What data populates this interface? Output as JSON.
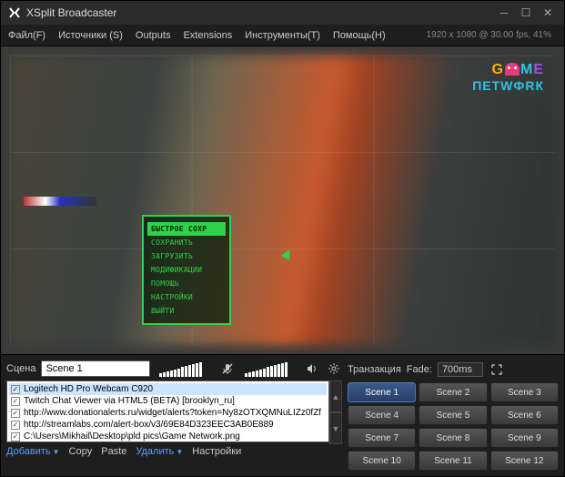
{
  "titlebar": {
    "title": "XSplit Broadcaster"
  },
  "menu": {
    "file": "Файл(F)",
    "sources": "Источники (S)",
    "outputs": "Outputs",
    "extensions": "Extensions",
    "tools": "Инструменты(T)",
    "help": "Помощь(H)",
    "status": "1920 x 1080 @ 30.00 fps, 41%"
  },
  "in_game_menu": {
    "items": [
      "БЫСТРОЕ СОХР",
      "СОХРАНИТЬ",
      "ЗАГРУЗИТЬ",
      "МОДИФИКАЦИИ",
      "ПОМОЩЬ",
      "НАСТРОЙКИ",
      "ВЫЙТИ"
    ],
    "selected_index": 0
  },
  "scene_panel": {
    "label": "Сцена",
    "current_scene": "Scene 1"
  },
  "sources_list": [
    {
      "checked": true,
      "selected": true,
      "label": "Logitech HD Pro Webcam C920"
    },
    {
      "checked": true,
      "selected": false,
      "label": "Twitch Chat Viewer via HTML5 (BETA) [brooklyn_ru]"
    },
    {
      "checked": true,
      "selected": false,
      "label": "http://www.donationalerts.ru/widget/alerts?token=Ny8zOTXQMNuLIZz0fZf"
    },
    {
      "checked": true,
      "selected": false,
      "label": "http://streamlabs.com/alert-box/v3/69E84D323EEC3AB0E889"
    },
    {
      "checked": true,
      "selected": false,
      "label": "C:\\Users\\Mikhail\\Desktop\\pld pics\\Game Network.png"
    }
  ],
  "source_toolbar": {
    "add": "Добавить",
    "copy": "Copy",
    "paste": "Paste",
    "delete": "Удалить",
    "settings": "Настройки"
  },
  "transition": {
    "label": "Транзакция",
    "fade_label": "Fade:",
    "fade_value": "700ms"
  },
  "scenes": [
    "Scene 1",
    "Scene 2",
    "Scene 3",
    "Scene 4",
    "Scene 5",
    "Scene 6",
    "Scene 7",
    "Scene 8",
    "Scene 9",
    "Scene 10",
    "Scene 11",
    "Scene 12"
  ],
  "active_scene_index": 0,
  "watermark_logo": {
    "line1": {
      "g": "G",
      "m": "M",
      "e": "E"
    },
    "line2": "ПETWФRК"
  }
}
